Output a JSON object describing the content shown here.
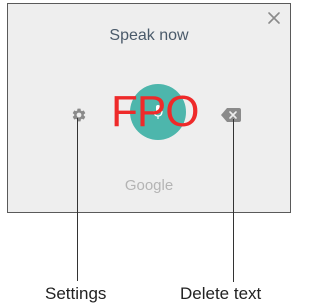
{
  "dialog": {
    "title": "Speak now",
    "brand": "Google",
    "overlay_text": "FPO",
    "icons": {
      "close": "close-icon",
      "microphone": "microphone-icon",
      "settings": "gear-icon",
      "delete": "backspace-icon"
    },
    "colors": {
      "panel_background": "#eeeeee",
      "mic_button": "#4db6ac",
      "overlay_text": "#ee2a2a",
      "title": "#4a5a6a",
      "brand": "#b4b4b4",
      "icon": "#8a8a8a"
    }
  },
  "callouts": {
    "settings": "Settings",
    "delete": "Delete text"
  }
}
